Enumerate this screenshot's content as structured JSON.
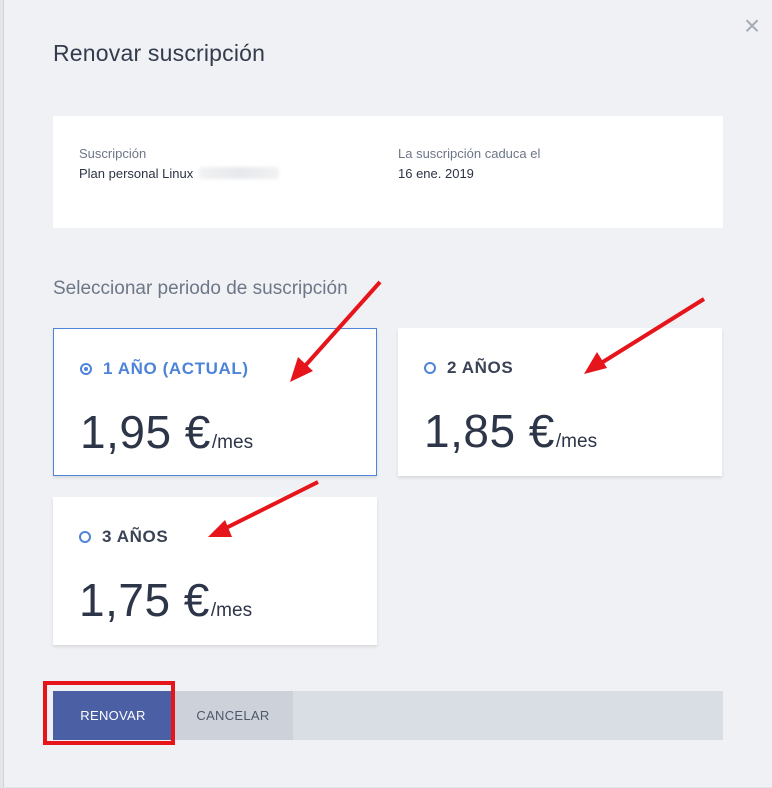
{
  "dialog": {
    "title": "Renovar suscripción",
    "close_icon": "close-icon",
    "info": {
      "subscription_label": "Suscripción",
      "subscription_value": "Plan personal Linux",
      "expiry_label": "La suscripción caduca el",
      "expiry_value": "16 ene. 2019"
    },
    "period_title": "Seleccionar periodo de suscripción",
    "plans": [
      {
        "label": "1 AÑO (ACTUAL)",
        "price": "1,95 €",
        "per": "/mes",
        "selected": true
      },
      {
        "label": "2 AÑOS",
        "price": "1,85 €",
        "per": "/mes",
        "selected": false
      },
      {
        "label": "3 AÑOS",
        "price": "1,75 €",
        "per": "/mes",
        "selected": false
      }
    ],
    "buttons": {
      "renew": "RENOVAR",
      "cancel": "CANCELAR"
    }
  },
  "colors": {
    "accent": "#4d84d8",
    "primary_button": "#4b5fa5",
    "annotation": "#e6141b"
  }
}
